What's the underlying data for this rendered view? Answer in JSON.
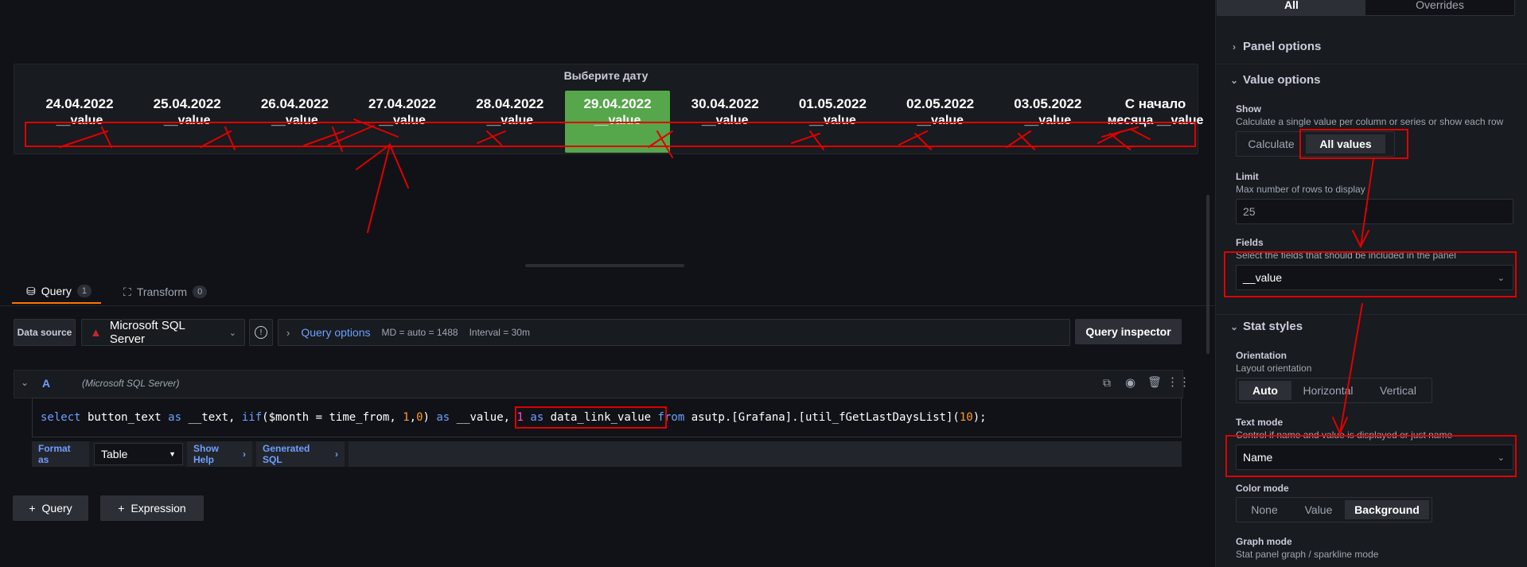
{
  "stat_panel": {
    "title": "Выберите дату",
    "items": [
      {
        "date": "24.04.2022",
        "value": "__value"
      },
      {
        "date": "25.04.2022",
        "value": "__value"
      },
      {
        "date": "26.04.2022",
        "value": "__value"
      },
      {
        "date": "27.04.2022",
        "value": "__value"
      },
      {
        "date": "28.04.2022",
        "value": "__value"
      },
      {
        "date": "29.04.2022",
        "value": "__value",
        "active": true
      },
      {
        "date": "30.04.2022",
        "value": "__value"
      },
      {
        "date": "01.05.2022",
        "value": "__value"
      },
      {
        "date": "02.05.2022",
        "value": "__value"
      },
      {
        "date": "03.05.2022",
        "value": "__value"
      },
      {
        "date": "С начало",
        "value": "месяца __value"
      }
    ],
    "active_color": "#56a64b"
  },
  "tabs": {
    "query": {
      "label": "Query",
      "count": "1"
    },
    "transform": {
      "label": "Transform",
      "count": "0"
    }
  },
  "datasource": {
    "label": "Data source",
    "name": "Microsoft SQL Server",
    "query_options": "Query options",
    "md": "MD = auto = 1488",
    "interval": "Interval = 30m",
    "inspector": "Query inspector"
  },
  "query_a": {
    "ref": "A",
    "source": "(Microsoft SQL Server)",
    "sql": {
      "p1": "select",
      "p2": " button_text ",
      "p3": "as",
      "p4": " __text, ",
      "p5": "iif",
      "p6": "($month = time_from, ",
      "p7": "1",
      "p8": ",",
      "p9": "0",
      "p10": ") ",
      "p11": "as",
      "p12": " __value, ",
      "p13": "1",
      "p14": " ",
      "p15": "as",
      "p16": " data_link_value ",
      "p17": "from",
      "p18": " asutp.[Grafana].[util_fGetLastDaysList](",
      "p19": "10",
      "p20": ");"
    },
    "format_as_label": "Format as",
    "format_as_value": "Table",
    "show_help": "Show Help",
    "generated_sql": "Generated SQL"
  },
  "add_buttons": {
    "query": "Query",
    "expression": "Expression"
  },
  "options": {
    "tabs": {
      "all": "All",
      "overrides": "Overrides"
    },
    "panel_options": "Panel options",
    "value_options": "Value options",
    "show": {
      "label": "Show",
      "desc": "Calculate a single value per column or series or show each row",
      "calculate": "Calculate",
      "all_values": "All values"
    },
    "limit": {
      "label": "Limit",
      "desc": "Max number of rows to display",
      "value": "25"
    },
    "fields": {
      "label": "Fields",
      "desc": "Select the fields that should be included in the panel",
      "value": "__value"
    },
    "stat_styles": "Stat styles",
    "orientation": {
      "label": "Orientation",
      "desc": "Layout orientation",
      "auto": "Auto",
      "horizontal": "Horizontal",
      "vertical": "Vertical"
    },
    "text_mode": {
      "label": "Text mode",
      "desc": "Control if name and value is displayed or just name",
      "value": "Name"
    },
    "color_mode": {
      "label": "Color mode",
      "none": "None",
      "value": "Value",
      "background": "Background"
    },
    "graph_mode": {
      "label": "Graph mode",
      "desc": "Stat panel graph / sparkline mode"
    }
  }
}
